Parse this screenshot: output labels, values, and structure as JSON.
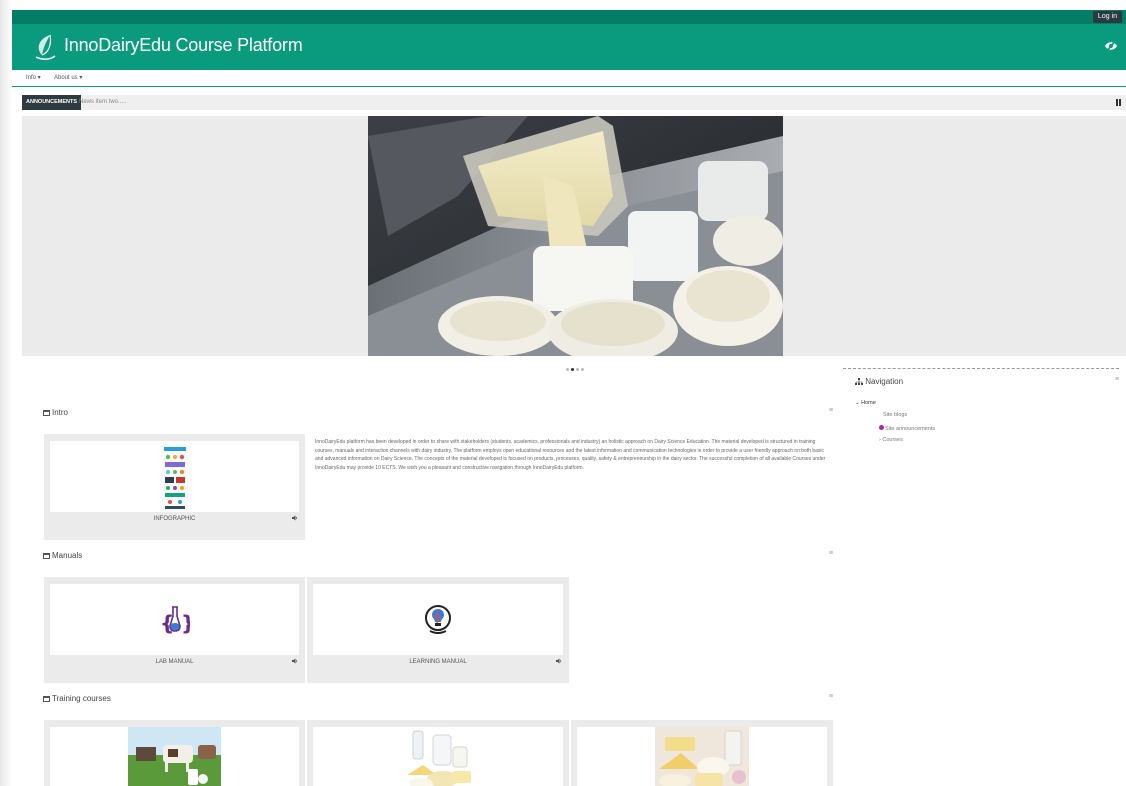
{
  "topbar": {
    "login_label": "Log in"
  },
  "header": {
    "site_title": "InnoDairyEdu Course Platform",
    "brand_color": "#0a9b7e"
  },
  "menu": {
    "items": [
      {
        "label": "Info ▾"
      },
      {
        "label": "About us ▾"
      }
    ]
  },
  "announcements": {
    "label": "ANNOUNCEMENTS",
    "news": "News item two....."
  },
  "sections": {
    "intro": {
      "title": "Intro",
      "card_label": "INFOGRAPHIC",
      "text": "InnoDairyEdu platform has been developed in order to share with stakeholders (students, academics, professionals and industry) an holistic approach on Dairy Science Education. The material developed is structured in training courses, manuals and interaction channels with dairy industry. The platform employs open educational resources and the latest information and communication technologies in order to provide a user friendly approach on both basic and advanced information on Dairy Science. The concepts of the material developed is focused on products, processes, quality, safety & entrepreneurship in the dairy sector. The successful completion of all available Courses under InnoDairyEdu may provide 10 ECTS. We wish you a pleasant and constructive navigation through InnoDairyEdu platform."
    },
    "manuals": {
      "title": "Manuals",
      "cards": [
        {
          "label": "LAB MANUAL"
        },
        {
          "label": "LEARNING MANUAL"
        }
      ]
    },
    "training": {
      "title": "Training courses"
    }
  },
  "navigation": {
    "title": "Navigation",
    "items": [
      {
        "label": "Home"
      },
      {
        "label": "Site blogs"
      },
      {
        "label": "Site announcements"
      },
      {
        "label": "Courses"
      }
    ]
  }
}
